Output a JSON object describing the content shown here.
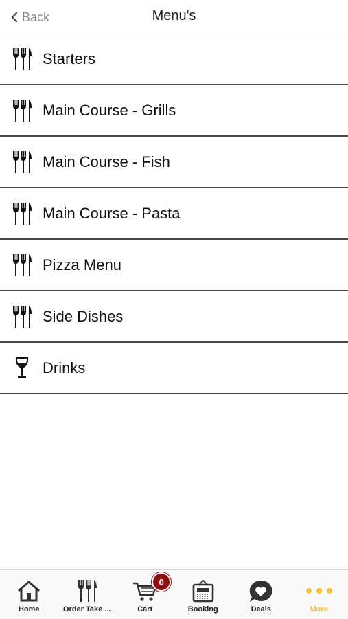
{
  "header": {
    "back_label": "Back",
    "title": "Menu's"
  },
  "menu": [
    {
      "label": "Starters",
      "icon": "cutlery-icon"
    },
    {
      "label": "Main Course - Grills",
      "icon": "cutlery-icon"
    },
    {
      "label": "Main Course - Fish",
      "icon": "cutlery-icon"
    },
    {
      "label": "Main Course - Pasta",
      "icon": "cutlery-icon"
    },
    {
      "label": "Pizza Menu",
      "icon": "cutlery-icon"
    },
    {
      "label": "Side Dishes",
      "icon": "cutlery-icon"
    },
    {
      "label": "Drinks",
      "icon": "wine-glass-icon"
    }
  ],
  "tabbar": {
    "tabs": [
      {
        "label": "Home",
        "icon": "home-icon"
      },
      {
        "label": "Order Take ...",
        "icon": "cutlery-icon"
      },
      {
        "label": "Cart",
        "icon": "cart-icon"
      },
      {
        "label": "Booking",
        "icon": "booking-icon"
      },
      {
        "label": "Deals",
        "icon": "heart-bubble-icon"
      },
      {
        "label": "More",
        "icon": "more-dots-icon"
      }
    ],
    "cart_count": "0",
    "active_tab": "More",
    "active_color": "#f3c13a",
    "badge_color": "#8b1111"
  }
}
